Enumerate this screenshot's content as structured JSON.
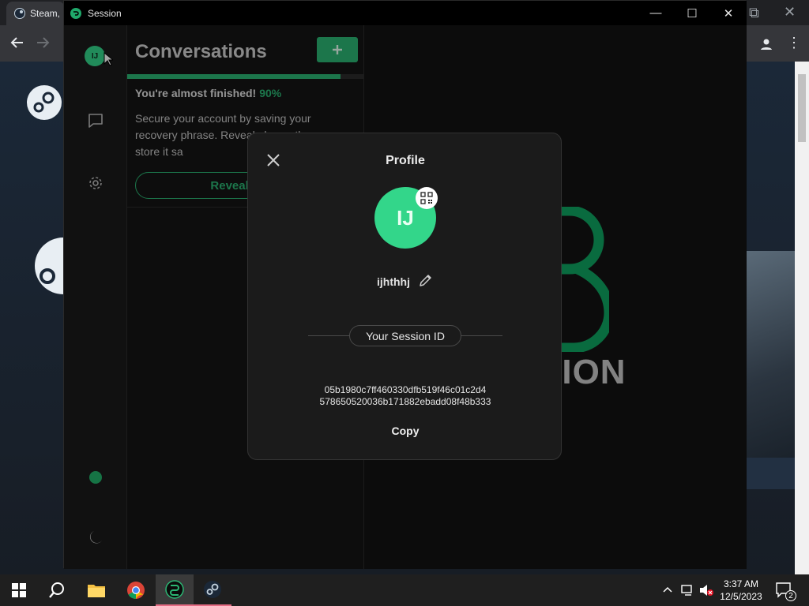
{
  "browser": {
    "tab_title": "Steam,"
  },
  "session_window": {
    "title": "Session",
    "controls": {
      "minimize": "—",
      "maximize": "☐",
      "close": "✕"
    }
  },
  "leftnav": {
    "avatar_initials": "IJ"
  },
  "conversations": {
    "title": "Conversations",
    "add_label": "+",
    "progress_pct": 90,
    "almost_text": "You're almost finished!",
    "almost_pct_text": "90%",
    "secure_text": "Secure your account by saving your recovery phrase. Reveal phrase then store it sa",
    "reveal_button": "Reveal Reco"
  },
  "main": {
    "wordmark": "SION"
  },
  "profile_modal": {
    "title": "Profile",
    "avatar_initials": "IJ",
    "username": "ijhthhj",
    "session_id_label": "Your Session ID",
    "session_id_line1": "05b1980c7ff460330dfb519f46c01c2d4",
    "session_id_line2": "578650520036b171882ebadd08f48b333",
    "copy_label": "Copy"
  },
  "taskbar": {
    "time": "3:37 AM",
    "date": "12/5/2023",
    "notification_count": "2"
  },
  "colors": {
    "accent": "#2bb673",
    "avatar": "#33d68a",
    "window_bg": "#121212"
  }
}
